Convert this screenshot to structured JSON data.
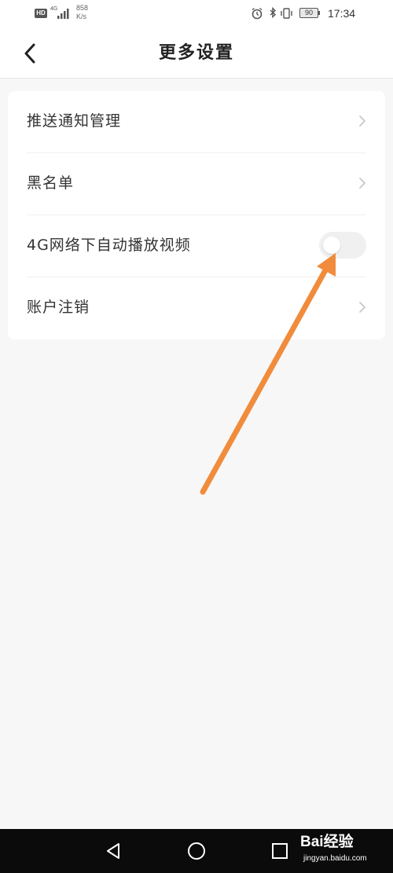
{
  "status_bar": {
    "hd_label": "HD",
    "network_type": "4G",
    "speed_value": "858",
    "speed_unit": "K/s",
    "battery_level": "90",
    "time": "17:34",
    "icons": [
      "alarm-icon",
      "bluetooth-icon",
      "vibrate-icon",
      "battery-icon"
    ]
  },
  "header": {
    "back_icon": "chevron-left-icon",
    "title": "更多设置"
  },
  "settings": {
    "items": [
      {
        "label": "推送通知管理",
        "control": "chevron-right-icon"
      },
      {
        "label": "黑名单",
        "control": "chevron-right-icon"
      },
      {
        "label": "4G网络下自动播放视频",
        "control": "toggle",
        "enabled": false
      },
      {
        "label": "账户注销",
        "control": "chevron-right-icon"
      }
    ]
  },
  "annotation": {
    "arrow_color": "#f08c3c"
  },
  "nav_bar": {
    "buttons": [
      "back-triangle-icon",
      "home-circle-icon",
      "recents-square-icon"
    ]
  },
  "watermark": {
    "text": "Bai经验",
    "subtext": "jingyan.baidu.com"
  },
  "colors": {
    "background": "#f7f7f7",
    "card": "#ffffff",
    "nav_bar": "#0b0b0b",
    "toggle_off": "#f0f0f0"
  }
}
